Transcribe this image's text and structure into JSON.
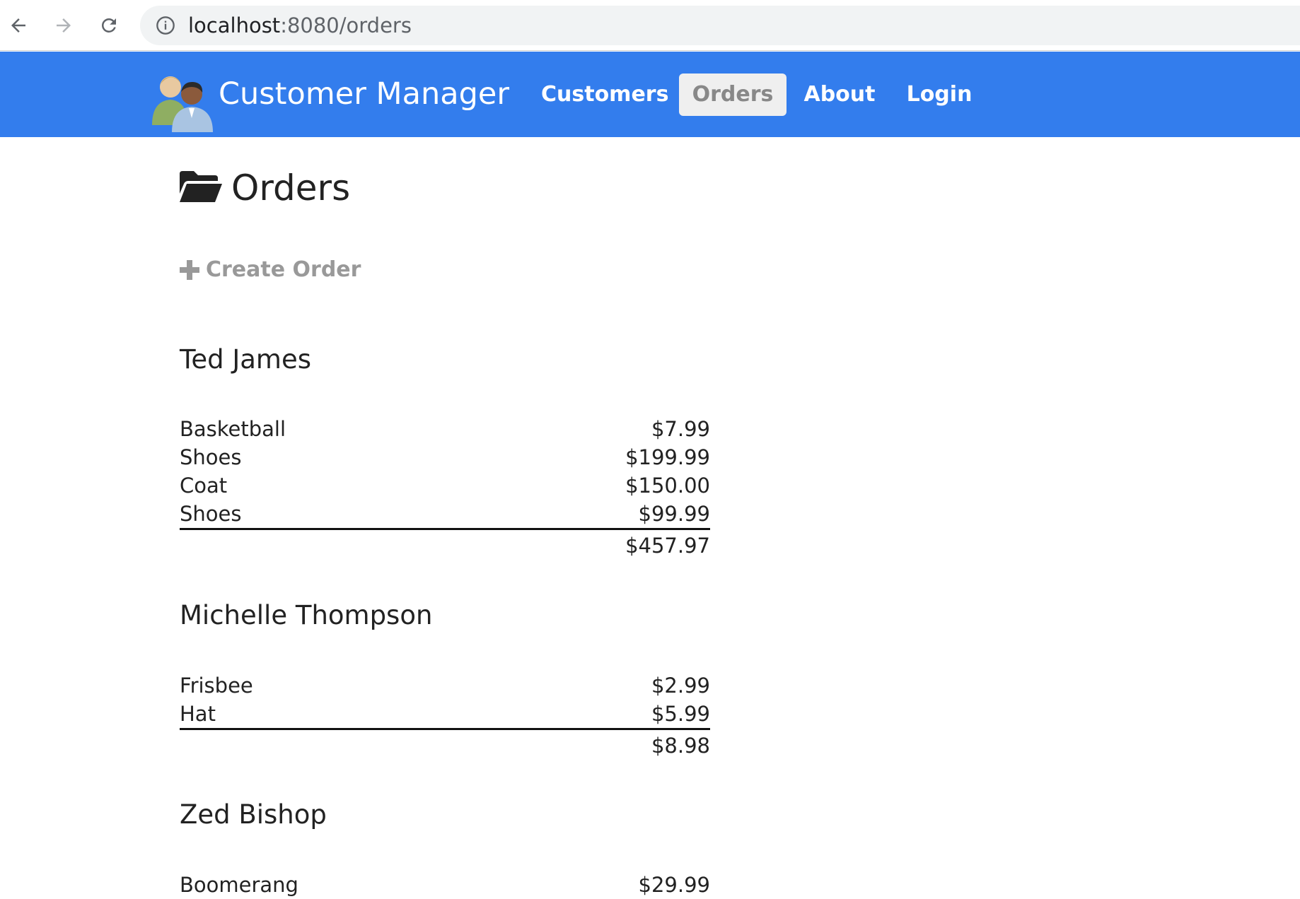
{
  "browser": {
    "url_host": "localhost",
    "url_rest": ":8080/orders",
    "back_icon": "arrow-left-icon",
    "forward_icon": "arrow-right-icon",
    "reload_icon": "reload-icon",
    "info_icon": "info-icon"
  },
  "navbar": {
    "brand": "Customer Manager",
    "logo_icon": "users-icon",
    "bg_color": "#337ded",
    "links": [
      {
        "label": "Customers",
        "active": false
      },
      {
        "label": "Orders",
        "active": true
      },
      {
        "label": "About",
        "active": false
      },
      {
        "label": "Login",
        "active": false
      }
    ]
  },
  "page": {
    "title": "Orders",
    "title_icon": "folder-open-icon",
    "create_label": "Create Order",
    "create_icon": "plus-icon"
  },
  "customers": [
    {
      "name": "Ted James",
      "items": [
        {
          "product": "Basketball",
          "price": "$7.99"
        },
        {
          "product": "Shoes",
          "price": "$199.99"
        },
        {
          "product": "Coat",
          "price": "$150.00"
        },
        {
          "product": "Shoes",
          "price": "$99.99"
        }
      ],
      "total": "$457.97"
    },
    {
      "name": "Michelle Thompson",
      "items": [
        {
          "product": "Frisbee",
          "price": "$2.99"
        },
        {
          "product": "Hat",
          "price": "$5.99"
        }
      ],
      "total": "$8.98"
    },
    {
      "name": "Zed Bishop",
      "items": [
        {
          "product": "Boomerang",
          "price": "$29.99"
        }
      ]
    }
  ]
}
